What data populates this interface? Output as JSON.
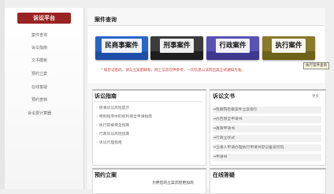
{
  "sidebar": {
    "header": "诉讼平台",
    "items": [
      "案件查询",
      "诉讼指南",
      "文书模板",
      "预约立案",
      "在线答疑",
      "预约查档",
      "诉讼费计算器"
    ]
  },
  "case_query": {
    "title": "案件查询",
    "buttons": [
      {
        "label": "民商事案件",
        "color": "#2a66c8",
        "stripe": "#1e4fa8"
      },
      {
        "label": "刑事案件",
        "color": "#3c3c3c",
        "stripe": "#1e1e1e"
      },
      {
        "label": "行政案件",
        "color": "#5a52b5",
        "stripe": "#3f3890"
      },
      {
        "label": "执行案件",
        "color": "#8a7a2a",
        "stripe": "#6e6118"
      }
    ],
    "notice": "* 如您记密码，请与立案庭联系，网上信息仅供参考，一切信息以法院出具正式通知为准。",
    "tooltip": "执行案件查询"
  },
  "litigation_guide": {
    "title": "诉讼指南",
    "items": [
      "民事诉讼风险提示",
      "特别程序中的权利保全申请指南",
      "执行前被保全指南",
      "行政诉讼风险指南",
      "诉讼代理指南"
    ]
  },
  "litigation_docs": {
    "title": "诉讼文书",
    "more": "更多",
    "items": [
      "↠检察院检察案件立案指引",
      "↠办告保全申请书",
      "↠再审申请书",
      "↠行政立状式",
      "↠当事人申请办理执行申请书登记备案页码",
      "↠申请书"
    ]
  },
  "appointment": {
    "title": "预约立案",
    "text": "为便您的立案流程更加简"
  },
  "online_qa": {
    "title": "在线答疑"
  },
  "colors": {
    "sidebar_header": "#9a2323",
    "notice": "#c43a3a"
  }
}
